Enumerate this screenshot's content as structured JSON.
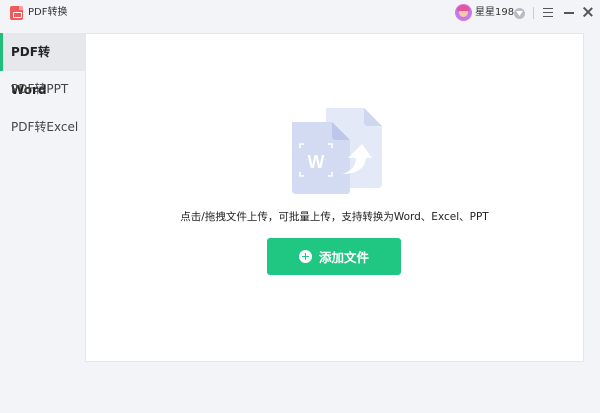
{
  "window": {
    "title": "PDF转换",
    "username": "星星198...",
    "icons": [
      "pdf-app-icon",
      "avatar",
      "vip-badge-icon",
      "menu-icon",
      "minimize-icon",
      "close-icon"
    ]
  },
  "sidebar": {
    "items": [
      {
        "label": "PDF转Word",
        "active": true
      },
      {
        "label": "PDF转PPT",
        "active": false
      },
      {
        "label": "PDF转Excel",
        "active": false
      }
    ]
  },
  "main": {
    "hint": "点击/拖拽文件上传，可批量上传，支持转换为Word、Excel、PPT",
    "add_button_label": "添加文件",
    "illustration_letter": "W"
  },
  "colors": {
    "accent": "#20c782",
    "active_indicator": "#1fbf7a",
    "background": "#f3f4f7",
    "panel": "#ffffff"
  }
}
